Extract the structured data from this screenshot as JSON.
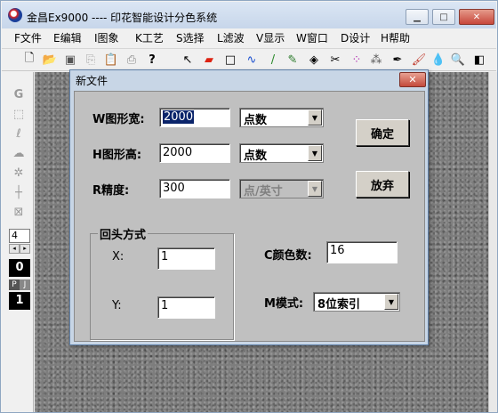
{
  "app": {
    "title": "金昌Ex9000 ---- 印花智能设计分色系统",
    "menu": [
      "F文件",
      "E编辑",
      "I图象",
      "K工艺",
      "S选择",
      "L滤波",
      "V显示",
      "W窗口",
      "D设计",
      "H帮助"
    ]
  },
  "sidebar": {
    "brush_size": "4",
    "value_zero": "0",
    "value_one": "1",
    "mode_p": "P",
    "mode_j": "J"
  },
  "dialog": {
    "title": "新文件",
    "width_label": "W图形宽:",
    "width_value": "2000",
    "width_unit": "点数",
    "height_label": "H图形高:",
    "height_value": "2000",
    "height_unit": "点数",
    "resolution_label": "R精度:",
    "resolution_value": "300",
    "resolution_unit": "点/英寸",
    "group_title": "回头方式",
    "x_label": "X:",
    "x_value": "1",
    "y_label": "Y:",
    "y_value": "1",
    "colors_label": "C颜色数:",
    "colors_value": "16",
    "mode_label": "M模式:",
    "mode_value": "8位索引",
    "ok_label": "确定",
    "cancel_label": "放弃"
  }
}
